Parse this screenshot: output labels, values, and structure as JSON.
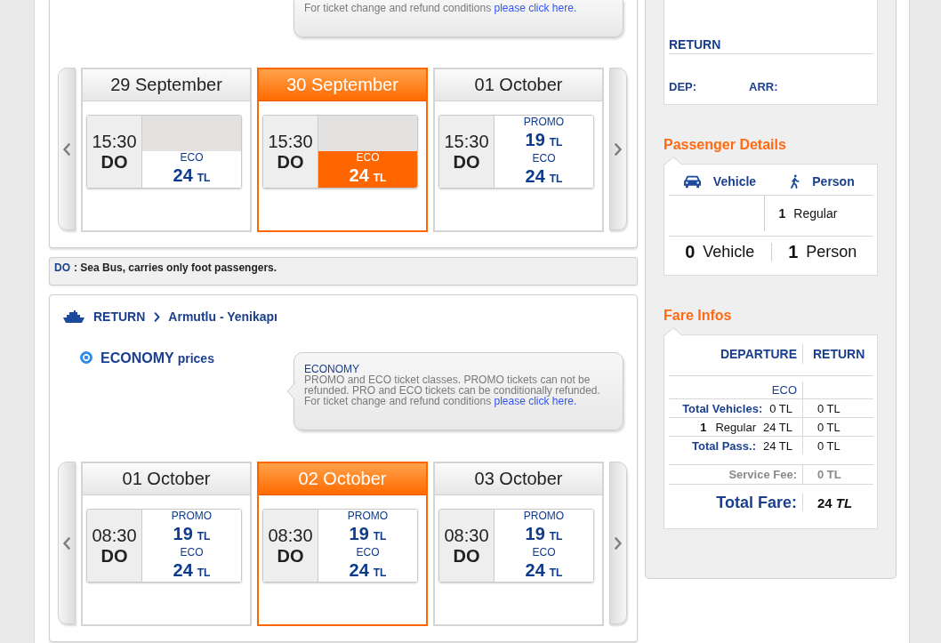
{
  "departure_section": {
    "info_bubble": {
      "paragraphs": [
        {
          "text": "For ticket change and refund conditions",
          "link": "please click here."
        }
      ]
    },
    "days": [
      {
        "date": "29 September",
        "selected": false,
        "trips": [
          {
            "time": "15:30",
            "vessel": "DO",
            "fares": [
              {
                "kind": "empty"
              },
              {
                "kind": "fare",
                "class": "ECO",
                "price": "24",
                "currency": "TL",
                "selected": false
              }
            ]
          }
        ]
      },
      {
        "date": "30 September",
        "selected": true,
        "trips": [
          {
            "time": "15:30",
            "vessel": "DO",
            "fares": [
              {
                "kind": "empty"
              },
              {
                "kind": "fare",
                "class": "ECO",
                "price": "24",
                "currency": "TL",
                "selected": true
              }
            ]
          }
        ]
      },
      {
        "date": "01 October",
        "selected": false,
        "trips": [
          {
            "time": "15:30",
            "vessel": "DO",
            "fares": [
              {
                "kind": "fare",
                "class": "PROMO",
                "price": "19",
                "currency": "TL",
                "selected": false
              },
              {
                "kind": "fare",
                "class": "ECO",
                "price": "24",
                "currency": "TL",
                "selected": false
              }
            ]
          }
        ]
      }
    ]
  },
  "legend": {
    "code": "DO",
    "text": ": Sea Bus, carries only foot passengers."
  },
  "return_section": {
    "direction": "RETURN",
    "route": "Armutlu - Yenikapı",
    "fare_option": {
      "label": "ECONOMY",
      "suffix": "prices",
      "selected": true
    },
    "info_bubble": {
      "title": "ECONOMY",
      "paragraphs": [
        {
          "text": "PROMO and ECO ticket classes. PROMO tickets can not be refunded. PRO and ECO tickets can be conditionally refunded."
        },
        {
          "text": "For ticket change and refund conditions",
          "link": "please click here."
        }
      ]
    },
    "days": [
      {
        "date": "01 October",
        "selected": false,
        "trips": [
          {
            "time": "08:30",
            "vessel": "DO",
            "fares": [
              {
                "kind": "fare",
                "class": "PROMO",
                "price": "19",
                "currency": "TL",
                "selected": false
              },
              {
                "kind": "fare",
                "class": "ECO",
                "price": "24",
                "currency": "TL",
                "selected": false
              }
            ]
          }
        ]
      },
      {
        "date": "02 October",
        "selected": true,
        "trips": [
          {
            "time": "08:30",
            "vessel": "DO",
            "fares": [
              {
                "kind": "fare",
                "class": "PROMO",
                "price": "19",
                "currency": "TL",
                "selected": false
              },
              {
                "kind": "fare",
                "class": "ECO",
                "price": "24",
                "currency": "TL",
                "selected": false
              }
            ]
          }
        ]
      },
      {
        "date": "03 October",
        "selected": false,
        "trips": [
          {
            "time": "08:30",
            "vessel": "DO",
            "fares": [
              {
                "kind": "fare",
                "class": "PROMO",
                "price": "19",
                "currency": "TL",
                "selected": false
              },
              {
                "kind": "fare",
                "class": "ECO",
                "price": "24",
                "currency": "TL",
                "selected": false
              }
            ]
          }
        ]
      }
    ]
  },
  "sidebar": {
    "trip_summary": {
      "heading": "RETURN",
      "departure_label": "DEP:",
      "arrival_label": "ARR:"
    },
    "passenger_details": {
      "title": "Passenger Details",
      "columns": [
        {
          "kind": "vehicle",
          "label": "Vehicle"
        },
        {
          "kind": "person",
          "label": "Person"
        }
      ],
      "passengers": [
        {
          "count": "1",
          "type": "Regular"
        }
      ],
      "totals": [
        {
          "count": "0",
          "label": "Vehicle"
        },
        {
          "count": "1",
          "label": "Person"
        }
      ]
    },
    "fare_infos": {
      "title": "Fare Infos",
      "columns": [
        "DEPARTURE",
        "RETURN"
      ],
      "fare_class": "ECO",
      "rows": [
        {
          "kind": "total",
          "label": "Total Vehicles:",
          "departure": "0 TL",
          "return": "0 TL"
        },
        {
          "kind": "passenger",
          "count": "1",
          "label": "Regular",
          "departure": "24 TL",
          "return": "0 TL"
        },
        {
          "kind": "total",
          "label": "Total Pass.:",
          "departure": "24 TL",
          "return": "0 TL"
        }
      ],
      "service_fee": {
        "label": "Service Fee:",
        "return": "0 TL"
      },
      "total_fare": {
        "label": "Total Fare:",
        "amount": "24 *TL*"
      }
    }
  }
}
